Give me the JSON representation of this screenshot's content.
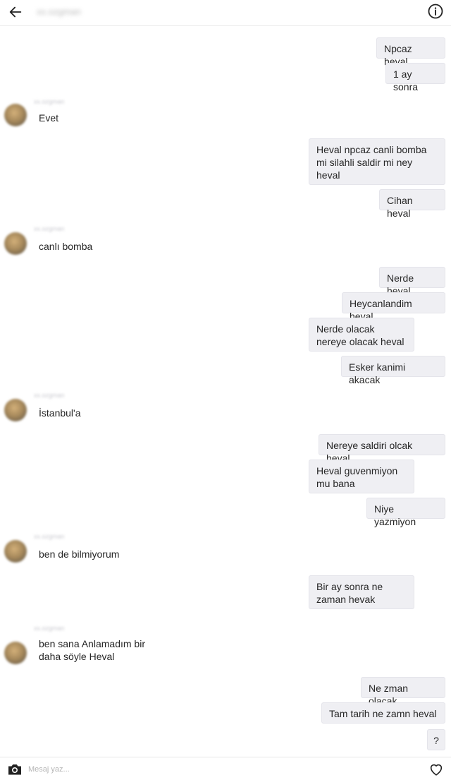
{
  "header": {
    "back_icon": "arrow-left-icon",
    "username": "xx.ozgman",
    "info_icon": "info-circle-icon"
  },
  "sender_name": "xx.ozgman",
  "messages": [
    {
      "dir": "out",
      "text": "Npcaz heval"
    },
    {
      "dir": "out",
      "text": "1 ay sonra"
    },
    {
      "dir": "in",
      "text": "Evet"
    },
    {
      "dir": "out",
      "text": "Heval npcaz canli bomba mi silahli saldir mi ney heval"
    },
    {
      "dir": "out",
      "text": "Cihan heval"
    },
    {
      "dir": "in",
      "text": "canlı bomba"
    },
    {
      "dir": "out",
      "text": "Nerde heval"
    },
    {
      "dir": "out",
      "text": "Heycanlandim heval"
    },
    {
      "dir": "out",
      "text": "Nerde olacak nereye olacak heval"
    },
    {
      "dir": "out",
      "text": "Esker kanimi akacak"
    },
    {
      "dir": "in",
      "text": "İstanbul'a"
    },
    {
      "dir": "out",
      "text": "Nereye saldiri olcak heval"
    },
    {
      "dir": "out",
      "text": "Heval guvenmiyon mu bana"
    },
    {
      "dir": "out",
      "text": "Niye yazmiyon"
    },
    {
      "dir": "in",
      "text": "ben de bilmiyorum"
    },
    {
      "dir": "out",
      "text": "Bir ay sonra ne zaman hevak"
    },
    {
      "dir": "in",
      "text": "ben sana Anlamadım bir daha söyle Heval"
    },
    {
      "dir": "out",
      "text": "Ne zman olacak"
    },
    {
      "dir": "out",
      "text": "Tam tarih ne zamn heval"
    },
    {
      "dir": "out",
      "text": "?"
    }
  ],
  "composer": {
    "camera_icon": "camera-icon",
    "placeholder": "Mesaj yaz...",
    "heart_icon": "heart-icon"
  }
}
